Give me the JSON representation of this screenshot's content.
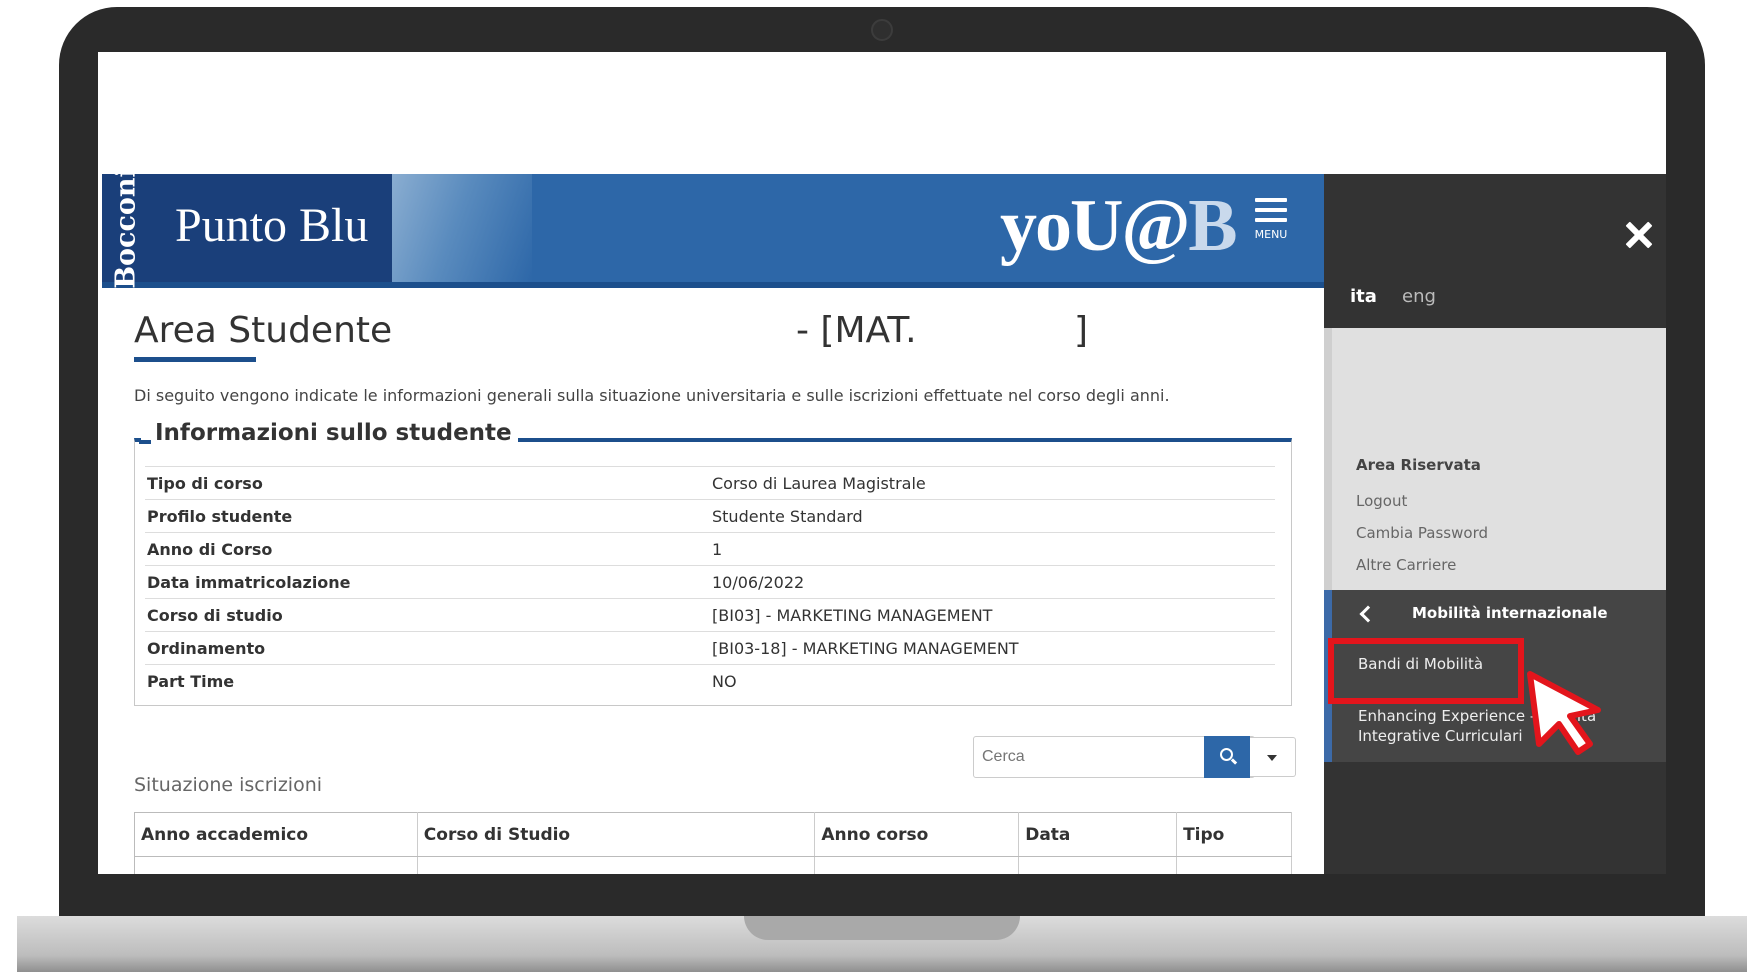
{
  "header": {
    "logo_vertical": "Bocconi",
    "logo_text": "Punto Blu",
    "brand_main": "yoU@",
    "brand_b": "B",
    "menu_label": "MENU"
  },
  "page": {
    "title": "Area Studente",
    "title_suffix": "- [MAT.",
    "title_bracket": "]",
    "intro": "Di seguito vengono indicate le informazioni generali sulla situazione universitaria e sulle iscrizioni effettuate nel corso degli anni."
  },
  "student_info": {
    "heading": "Informazioni sullo studente",
    "rows": [
      {
        "label": "Tipo di corso",
        "value": "Corso di Laurea Magistrale"
      },
      {
        "label": "Profilo studente",
        "value": "Studente Standard"
      },
      {
        "label": "Anno di Corso",
        "value": "1"
      },
      {
        "label": "Data immatricolazione",
        "value": "10/06/2022"
      },
      {
        "label": "Corso di studio",
        "value": "[BI03] - MARKETING MANAGEMENT"
      },
      {
        "label": "Ordinamento",
        "value": "[BI03-18] - MARKETING MANAGEMENT"
      },
      {
        "label": "Part Time",
        "value": "NO"
      }
    ]
  },
  "search": {
    "placeholder": "Cerca"
  },
  "enrollments": {
    "title": "Situazione iscrizioni",
    "columns": [
      "Anno accademico",
      "Corso di Studio",
      "Anno corso",
      "Data",
      "Tipo"
    ]
  },
  "sidemenu": {
    "lang_ita": "ita",
    "lang_eng": "eng",
    "reserved_title": "Area Riservata",
    "reserved_links": [
      "Logout",
      "Cambia Password",
      "Altre Carriere"
    ],
    "mobility_title": "Mobilità internazionale",
    "mobility_links": [
      "Bandi di Mobilità",
      "Enhancing Experience – Attività",
      "Integrative Curriculari"
    ]
  },
  "colors": {
    "header_blue": "#2d67a8",
    "logo_navy": "#1a3f7a",
    "menu_dark": "#333333",
    "highlight_red": "#e3151c"
  }
}
